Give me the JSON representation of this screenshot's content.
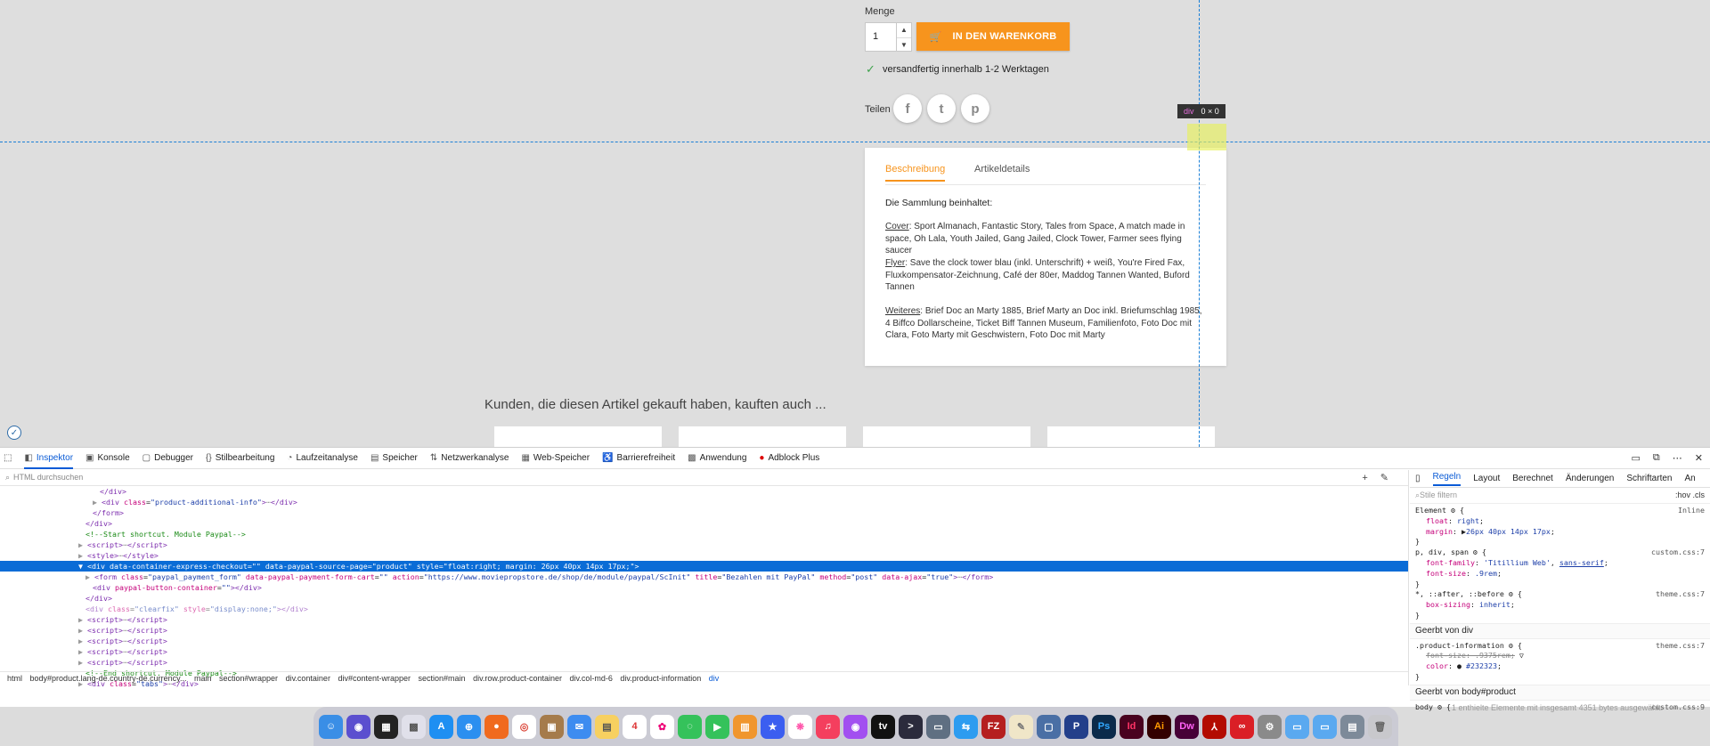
{
  "product": {
    "qty_label": "Menge",
    "qty_value": "1",
    "cart_label": "IN DEN WARENKORB",
    "shipping": "versandfertig innerhalb 1-2 Werktagen",
    "share_label": "Teilen",
    "social": [
      "f",
      "t",
      "p"
    ]
  },
  "inspector_tag": {
    "name": "div",
    "size": "0 × 0"
  },
  "card": {
    "tabs": [
      "Beschreibung",
      "Artikeldetails"
    ],
    "heading": "Die Sammlung beinhaltet:",
    "blocks": [
      {
        "label": "Cover",
        "text": ": Sport Almanach, Fantastic Story, Tales from Space, A match made in space, Oh Lala, Youth Jailed, Gang Jailed, Clock Tower, Farmer sees flying saucer"
      },
      {
        "label": "Flyer",
        "text": ": Save the clock tower blau (inkl. Unterschrift) + weiß, You're Fired Fax, Fluxkompensator-Zeichnung, Café der 80er, Maddog Tannen Wanted, Buford Tannen"
      },
      {
        "label": "Weiteres",
        "text": ": Brief Doc an Marty 1885, Brief Marty an Doc inkl. Briefumschlag 1985, 4 Biffco Dollarscheine, Ticket Biff Tannen Museum, Familienfoto, Foto Doc mit Clara, Foto Marty mit Geschwistern, Foto Doc mit Marty"
      }
    ]
  },
  "also_bought": "Kunden, die diesen Artikel gekauft haben, kauften auch ...",
  "devtools": {
    "tabs": [
      "Inspektor",
      "Konsole",
      "Debugger",
      "Stilbearbeitung",
      "Laufzeitanalyse",
      "Speicher",
      "Netzwerkanalyse",
      "Web-Speicher",
      "Barrierefreiheit",
      "Anwendung",
      "Adblock Plus"
    ],
    "search_placeholder": "HTML durchsuchen",
    "breadcrumbs": [
      "html",
      "body#product.lang-de.country-de.currency...",
      "main",
      "section#wrapper",
      "div.container",
      "div#content-wrapper",
      "section#main",
      "div.row.product-container",
      "div.col-md-6",
      "div.product-information",
      "div"
    ],
    "right_tabs": [
      "Regeln",
      "Layout",
      "Berechnet",
      "Änderungen",
      "Schriftarten",
      "An"
    ],
    "filter_placeholder": "Stile filtern",
    "filter_tools": ":hov .cls",
    "inherited_div": "Geerbt von div",
    "inherited_body": "Geerbt von body#product",
    "status": "1 enthielte Elemente mit insgesamt 4351 bytes ausgewählt."
  },
  "dock_date": "4",
  "colors": {
    "accent": "#f7941d",
    "select": "#0a6cd6",
    "guide": "#1a7fd6"
  }
}
